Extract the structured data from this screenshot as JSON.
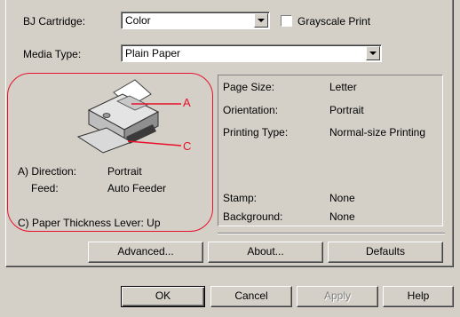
{
  "cartridge": {
    "label": "BJ Cartridge:",
    "value": "Color"
  },
  "grayscale": {
    "label": "Grayscale Print"
  },
  "media": {
    "label": "Media Type:",
    "value": "Plain Paper"
  },
  "preview": {
    "callout_a": "A",
    "callout_c": "C",
    "direction_label": "A) Direction:",
    "direction_value": "Portrait",
    "feed_label": "Feed:",
    "feed_value": "Auto Feeder",
    "thickness": "C) Paper Thickness Lever:  Up"
  },
  "info": {
    "page_size_label": "Page Size:",
    "page_size_value": "Letter",
    "orientation_label": "Orientation:",
    "orientation_value": "Portrait",
    "printing_type_label": "Printing Type:",
    "printing_type_value": "Normal-size Printing",
    "stamp_label": "Stamp:",
    "stamp_value": "None",
    "background_label": "Background:",
    "background_value": "None"
  },
  "buttons": {
    "advanced": "Advanced...",
    "about": "About...",
    "defaults": "Defaults",
    "ok": "OK",
    "cancel": "Cancel",
    "apply": "Apply",
    "help": "Help"
  },
  "colors": {
    "callout": "#e8102a",
    "face": "#d4d0c8"
  }
}
